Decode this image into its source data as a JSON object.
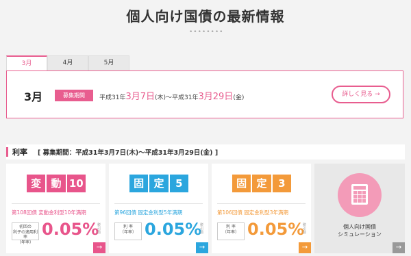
{
  "page_title": "個人向け国債の最新情報",
  "title_dots": "••••••••",
  "tabs": [
    {
      "label": "3月"
    },
    {
      "label": "4月"
    },
    {
      "label": "5月"
    }
  ],
  "info": {
    "month": "3月",
    "badge": "募集期間",
    "period_prefix": "平成31年",
    "period_start": "3月7日",
    "period_start_day": "(木)～平成31年",
    "period_end": "3月29日",
    "period_end_day": "(金)",
    "detail_button": "詳しく見る"
  },
  "rate": {
    "title": "利率",
    "period": "[ 募集期間：平成31年3月7日(木)～平成31年3月29日(金) ]"
  },
  "cards": [
    {
      "logo": [
        "変",
        "動",
        "10"
      ],
      "color": "#e8558b",
      "subtitle": "第108回債 変動金利型10年満期",
      "label_top": "初回の",
      "label_mid": "利子の適用利率",
      "label_bottom": "（年率）",
      "rate": "0.05%",
      "note": "税引前"
    },
    {
      "logo": [
        "固",
        "定",
        "5"
      ],
      "color": "#2ba6de",
      "subtitle": "第96回債 固定金利型5年満期",
      "label_top": "",
      "label_mid": "利 率",
      "label_bottom": "（年率）",
      "rate": "0.05%",
      "note": "税引前"
    },
    {
      "logo": [
        "固",
        "定",
        "3"
      ],
      "color": "#f39a3a",
      "subtitle": "第106回債 固定金利型3年満期",
      "label_top": "",
      "label_mid": "利 率",
      "label_bottom": "（年率）",
      "rate": "0.05%",
      "note": "税引前"
    }
  ],
  "simulation": {
    "line1": "個人向け国債",
    "line2": "シミュレーション",
    "icon": "calculator-icon"
  },
  "colors": {
    "accent": "#e85d8f",
    "background": "#f3f3f3"
  }
}
